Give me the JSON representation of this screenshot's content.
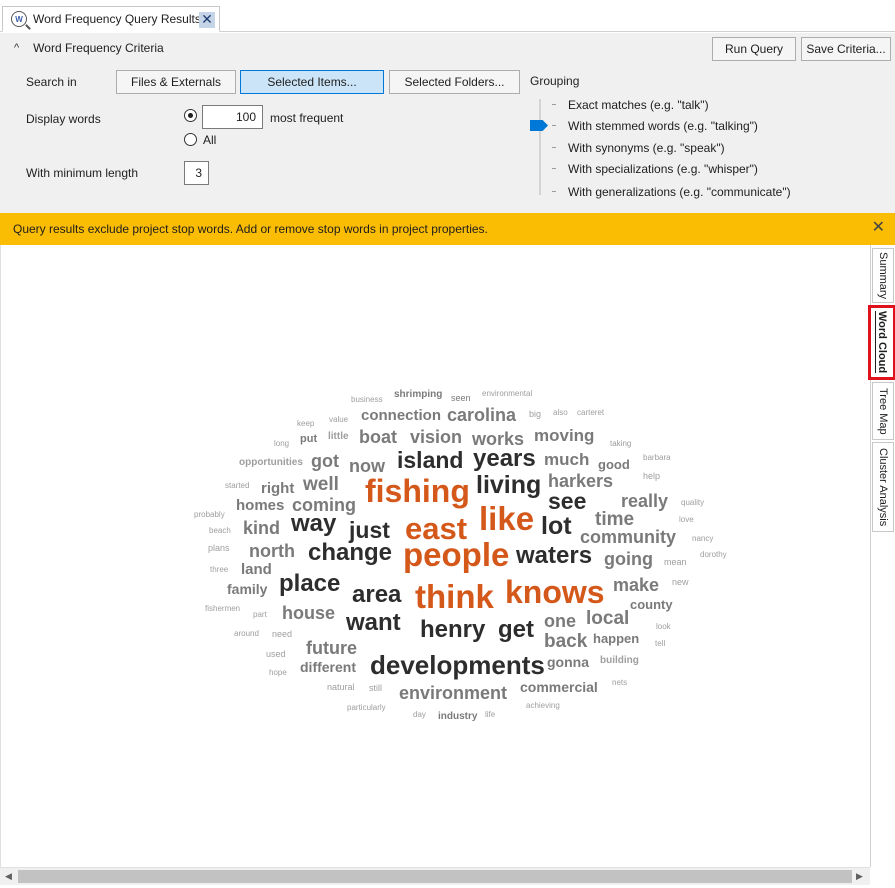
{
  "tab": {
    "title": "Word Frequency Query Results",
    "close": "✕"
  },
  "criteria": {
    "collapse_glyph": "^",
    "title": "Word Frequency Criteria",
    "run_query": "Run Query",
    "save_criteria": "Save Criteria...",
    "search_in_label": "Search in",
    "scope_buttons": [
      "Files & Externals",
      "Selected Items...",
      "Selected Folders..."
    ],
    "selected_scope": "Selected Items...",
    "grouping_label": "Grouping",
    "display_words_label": "Display words",
    "display_count": "100",
    "most_frequent": "most frequent",
    "all_label": "All",
    "min_length_label": "With minimum length",
    "min_length": "3",
    "grouping_options": [
      "Exact matches (e.g. \"talk\")",
      "With stemmed words (e.g. \"talking\")",
      "With synonyms (e.g. \"speak\")",
      "With specializations (e.g. \"whisper\")",
      "With generalizations (e.g. \"communicate\")"
    ],
    "grouping_selected_index": 1
  },
  "notification": {
    "text": "Query results exclude project stop words. Add or remove stop words in project properties.",
    "close": "✕"
  },
  "side_tabs": [
    "Summary",
    "Word Cloud",
    "Tree Map",
    "Cluster Analysis"
  ],
  "active_side_tab": "Word Cloud",
  "colors": {
    "accent": "#0078d7",
    "orange": "#d4581a",
    "dark": "#2d2d2d",
    "gray": "#7a7a7a",
    "light": "#9e9e9e",
    "banner": "#fbbc04",
    "highlight": "#e0101c"
  },
  "word_cloud": [
    {
      "t": "shrimping",
      "c": "gray"
    },
    {
      "t": "business",
      "c": "light"
    },
    {
      "t": "seen",
      "c": "gray"
    },
    {
      "t": "environmental",
      "c": "light"
    },
    {
      "t": "keep",
      "c": "light"
    },
    {
      "t": "value",
      "c": "light"
    },
    {
      "t": "connection",
      "c": "gray"
    },
    {
      "t": "carolina",
      "c": "gray"
    },
    {
      "t": "big",
      "c": "light"
    },
    {
      "t": "also",
      "c": "light"
    },
    {
      "t": "carteret",
      "c": "light"
    },
    {
      "t": "long",
      "c": "light"
    },
    {
      "t": "put",
      "c": "gray"
    },
    {
      "t": "little",
      "c": "light"
    },
    {
      "t": "boat",
      "c": "gray"
    },
    {
      "t": "vision",
      "c": "gray"
    },
    {
      "t": "works",
      "c": "gray"
    },
    {
      "t": "moving",
      "c": "gray"
    },
    {
      "t": "taking",
      "c": "light"
    },
    {
      "t": "opportunities",
      "c": "light"
    },
    {
      "t": "got",
      "c": "gray"
    },
    {
      "t": "now",
      "c": "gray"
    },
    {
      "t": "island",
      "c": "dark"
    },
    {
      "t": "years",
      "c": "dark"
    },
    {
      "t": "much",
      "c": "gray"
    },
    {
      "t": "good",
      "c": "gray"
    },
    {
      "t": "barbara",
      "c": "light"
    },
    {
      "t": "started",
      "c": "light"
    },
    {
      "t": "right",
      "c": "gray"
    },
    {
      "t": "well",
      "c": "gray"
    },
    {
      "t": "fishing",
      "c": "orange"
    },
    {
      "t": "living",
      "c": "dark"
    },
    {
      "t": "harkers",
      "c": "gray"
    },
    {
      "t": "help",
      "c": "light"
    },
    {
      "t": "probably",
      "c": "light"
    },
    {
      "t": "homes",
      "c": "gray"
    },
    {
      "t": "coming",
      "c": "gray"
    },
    {
      "t": "see",
      "c": "dark"
    },
    {
      "t": "really",
      "c": "gray"
    },
    {
      "t": "quality",
      "c": "light"
    },
    {
      "t": "beach",
      "c": "light"
    },
    {
      "t": "kind",
      "c": "gray"
    },
    {
      "t": "way",
      "c": "dark"
    },
    {
      "t": "just",
      "c": "dark"
    },
    {
      "t": "east",
      "c": "orange"
    },
    {
      "t": "like",
      "c": "orange"
    },
    {
      "t": "lot",
      "c": "dark"
    },
    {
      "t": "time",
      "c": "gray"
    },
    {
      "t": "love",
      "c": "light"
    },
    {
      "t": "plans",
      "c": "light"
    },
    {
      "t": "north",
      "c": "gray"
    },
    {
      "t": "change",
      "c": "dark"
    },
    {
      "t": "community",
      "c": "gray"
    },
    {
      "t": "nancy",
      "c": "light"
    },
    {
      "t": "three",
      "c": "light"
    },
    {
      "t": "land",
      "c": "gray"
    },
    {
      "t": "people",
      "c": "orange"
    },
    {
      "t": "waters",
      "c": "dark"
    },
    {
      "t": "going",
      "c": "gray"
    },
    {
      "t": "mean",
      "c": "light"
    },
    {
      "t": "dorothy",
      "c": "light"
    },
    {
      "t": "family",
      "c": "gray"
    },
    {
      "t": "place",
      "c": "dark"
    },
    {
      "t": "make",
      "c": "gray"
    },
    {
      "t": "new",
      "c": "light"
    },
    {
      "t": "fishermen",
      "c": "light"
    },
    {
      "t": "area",
      "c": "dark"
    },
    {
      "t": "think",
      "c": "orange"
    },
    {
      "t": "knows",
      "c": "orange"
    },
    {
      "t": "county",
      "c": "gray"
    },
    {
      "t": "part",
      "c": "light"
    },
    {
      "t": "house",
      "c": "gray"
    },
    {
      "t": "one",
      "c": "gray"
    },
    {
      "t": "local",
      "c": "gray"
    },
    {
      "t": "look",
      "c": "light"
    },
    {
      "t": "around",
      "c": "light"
    },
    {
      "t": "need",
      "c": "light"
    },
    {
      "t": "want",
      "c": "dark"
    },
    {
      "t": "henry",
      "c": "dark"
    },
    {
      "t": "get",
      "c": "dark"
    },
    {
      "t": "back",
      "c": "gray"
    },
    {
      "t": "happen",
      "c": "gray"
    },
    {
      "t": "tell",
      "c": "light"
    },
    {
      "t": "used",
      "c": "light"
    },
    {
      "t": "future",
      "c": "gray"
    },
    {
      "t": "developments",
      "c": "dark"
    },
    {
      "t": "gonna",
      "c": "gray"
    },
    {
      "t": "building",
      "c": "light"
    },
    {
      "t": "hope",
      "c": "light"
    },
    {
      "t": "different",
      "c": "gray"
    },
    {
      "t": "nets",
      "c": "light"
    },
    {
      "t": "natural",
      "c": "light"
    },
    {
      "t": "still",
      "c": "light"
    },
    {
      "t": "environment",
      "c": "gray"
    },
    {
      "t": "commercial",
      "c": "gray"
    },
    {
      "t": "particularly",
      "c": "light"
    },
    {
      "t": "achieving",
      "c": "light"
    },
    {
      "t": "day",
      "c": "light"
    },
    {
      "t": "industry",
      "c": "gray"
    },
    {
      "t": "life",
      "c": "light"
    }
  ]
}
